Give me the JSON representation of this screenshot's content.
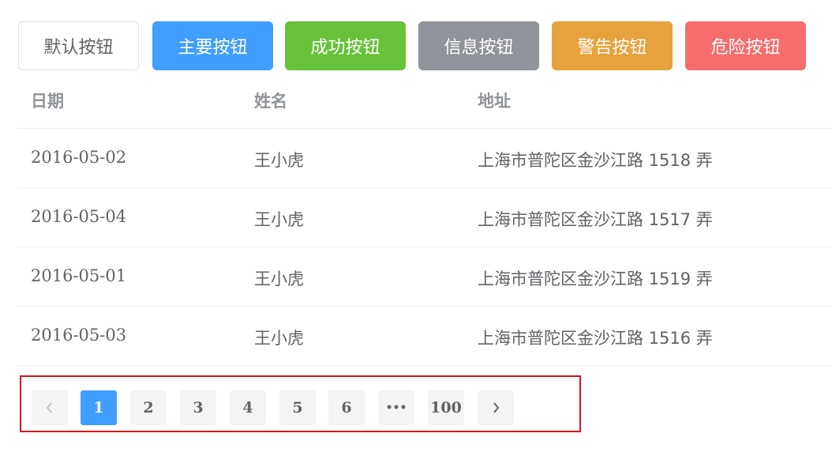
{
  "buttons": [
    {
      "label": "默认按钮",
      "type": "default"
    },
    {
      "label": "主要按钮",
      "type": "primary"
    },
    {
      "label": "成功按钮",
      "type": "success"
    },
    {
      "label": "信息按钮",
      "type": "info"
    },
    {
      "label": "警告按钮",
      "type": "warning"
    },
    {
      "label": "危险按钮",
      "type": "danger"
    }
  ],
  "table": {
    "headers": [
      "日期",
      "姓名",
      "地址"
    ],
    "rows": [
      [
        "2016-05-02",
        "王小虎",
        "上海市普陀区金沙江路 1518 弄"
      ],
      [
        "2016-05-04",
        "王小虎",
        "上海市普陀区金沙江路 1517 弄"
      ],
      [
        "2016-05-01",
        "王小虎",
        "上海市普陀区金沙江路 1519 弄"
      ],
      [
        "2016-05-03",
        "王小虎",
        "上海市普陀区金沙江路 1516 弄"
      ]
    ]
  },
  "pagination": {
    "prev_icon": "chevron-left-icon",
    "next_icon": "chevron-right-icon",
    "pages": [
      "1",
      "2",
      "3",
      "4",
      "5",
      "6",
      "•••",
      "100"
    ],
    "current": "1"
  },
  "colors": {
    "primary": "#409eff",
    "success": "#67c23a",
    "info": "#909399",
    "warning": "#e6a23c",
    "danger": "#f56c6c",
    "highlight_border": "#d9141e"
  }
}
